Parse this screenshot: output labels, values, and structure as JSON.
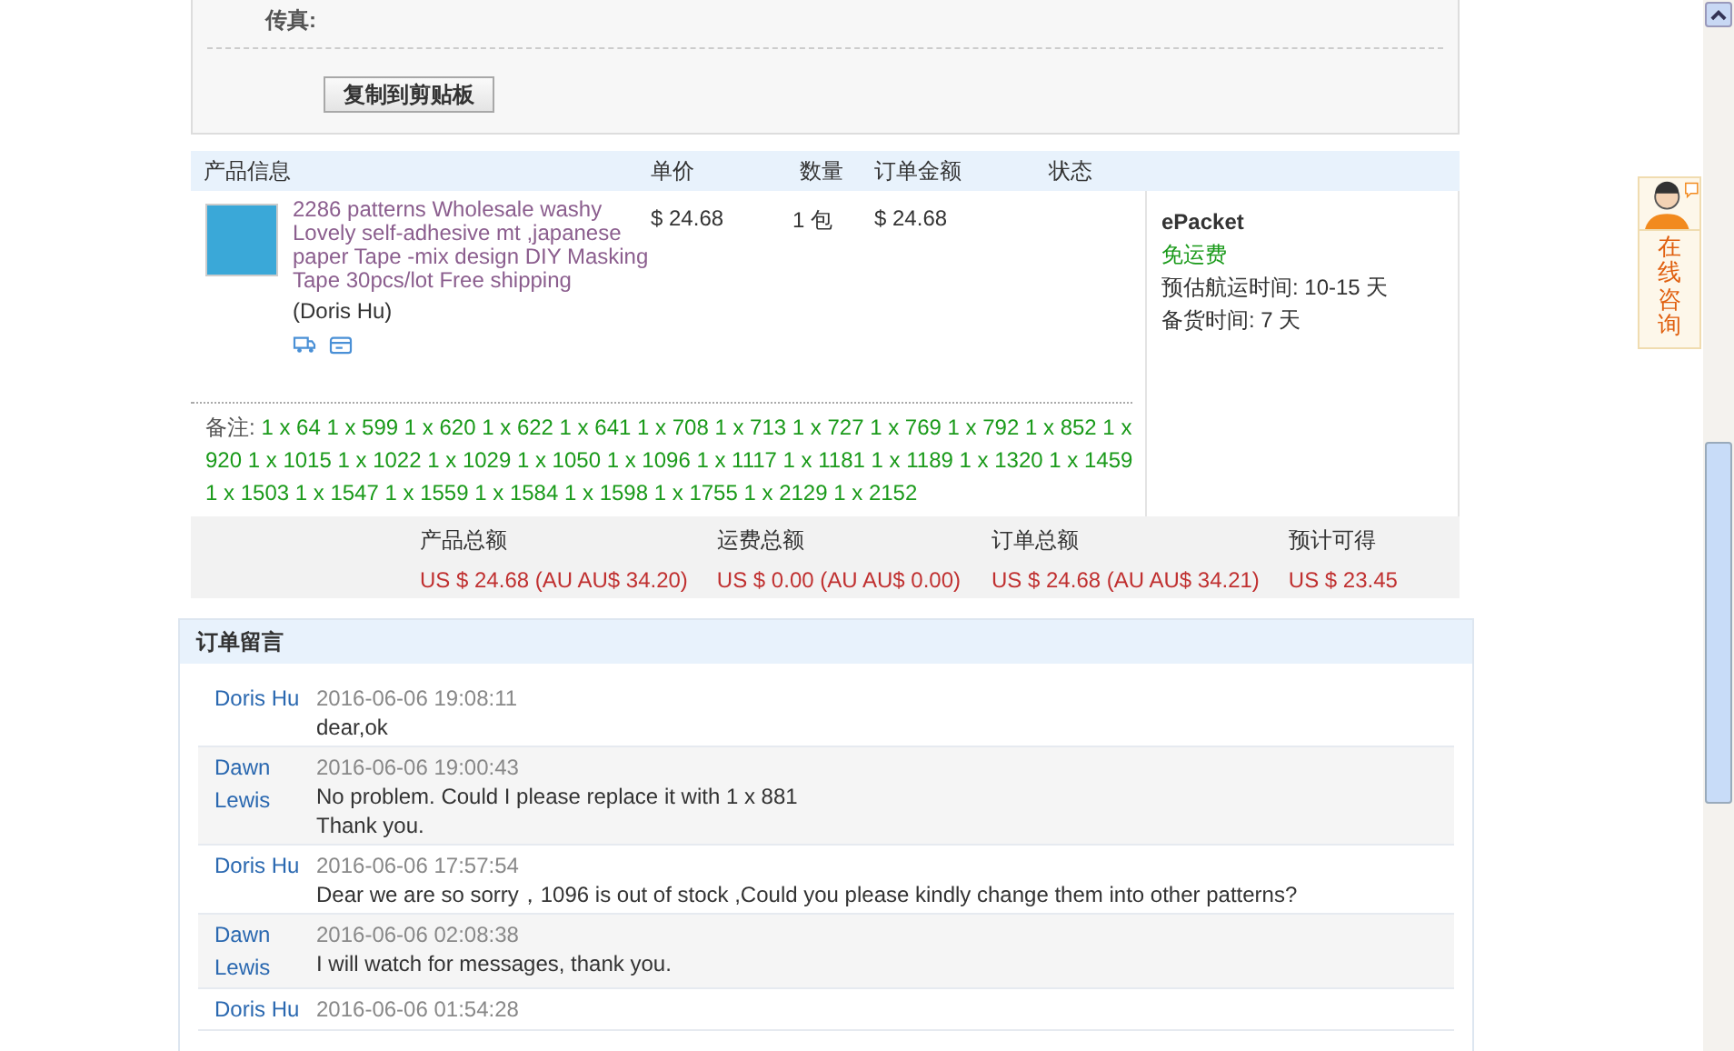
{
  "contact": {
    "fax_label": "传真:",
    "copy_button": "复制到剪贴板"
  },
  "order_table": {
    "columns": [
      "产品信息",
      "单价",
      "数量",
      "订单金额",
      "状态"
    ],
    "product": {
      "title": "2286 patterns Wholesale washy Lovely self-adhesive mt ,japanese paper Tape -mix design DIY Masking Tape 30pcs/lot Free shipping",
      "seller": "(Doris Hu)",
      "unit_price": "$ 24.68",
      "quantity": "1 包",
      "amount": "$ 24.68"
    },
    "note": {
      "label": "备注:",
      "text": "1 x 64 1 x 599 1 x 620 1 x 622 1 x 641 1 x 708 1 x 713 1 x 727 1 x 769 1 x 792 1 x 852 1 x 920 1 x 1015 1 x 1022 1 x 1029 1 x 1050 1 x 1096 1 x 1117 1 x 1181 1 x 1189 1 x 1320 1 x 1459 1 x 1503 1 x 1547 1 x 1559 1 x 1584 1 x 1598 1 x 1755 1 x 2129 1 x 2152"
    },
    "shipping": {
      "method": "ePacket",
      "fee": "免运费",
      "delivery_time": "预估航运时间: 10-15 天",
      "handling_time": "备货时间: 7 天"
    },
    "totals": [
      {
        "label": "产品总额",
        "value": "US $ 24.68 (AU AU$ 34.20)"
      },
      {
        "label": "运费总额",
        "value": "US $ 0.00 (AU AU$ 0.00)"
      },
      {
        "label": "订单总额",
        "value": "US $ 24.68 (AU AU$ 34.21)"
      },
      {
        "label": "预计可得",
        "value": "US $ 23.45"
      }
    ]
  },
  "messages": {
    "title": "订单留言",
    "items": [
      {
        "author": "Doris Hu",
        "time": "2016-06-06 19:08:11",
        "lines": [
          "dear,ok"
        ]
      },
      {
        "author": "Dawn Lewis",
        "time": "2016-06-06 19:00:43",
        "lines": [
          "No problem. Could I please replace it with 1 x 881",
          "Thank you."
        ]
      },
      {
        "author": "Doris Hu",
        "time": "2016-06-06 17:57:54",
        "lines": [
          "Dear we are so sorry，1096  is out of stock ,Could you please kindly change them into other patterns?"
        ]
      },
      {
        "author": "Dawn Lewis",
        "time": "2016-06-06 02:08:38",
        "lines": [
          "I will watch for messages, thank you."
        ]
      },
      {
        "author": "Doris Hu",
        "time": "2016-06-06 01:54:28"
      }
    ]
  },
  "consult": {
    "label": "在线咨询"
  }
}
